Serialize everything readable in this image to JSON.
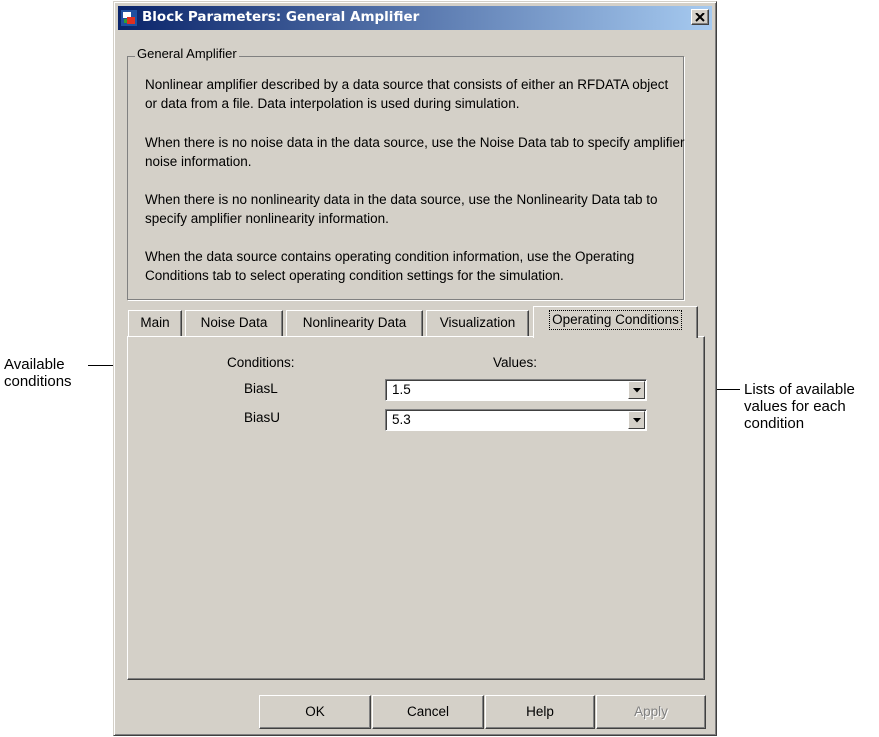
{
  "window": {
    "title": "Block Parameters: General Amplifier",
    "close_icon": "close-icon",
    "app_icon": "simulink-block-icon"
  },
  "group": {
    "label": "General Amplifier",
    "paragraphs": [
      "Nonlinear amplifier described by a data source that consists of either an RFDATA object or data from a file. Data interpolation is used during simulation.",
      "When there is no noise data in the data source, use the Noise Data tab to specify amplifier noise information.",
      "When there is no nonlinearity data in the data source, use the Nonlinearity Data tab to specify amplifier nonlinearity information.",
      "When the data source contains operating condition information, use the Operating Conditions tab to select operating condition settings for the simulation."
    ]
  },
  "tabs": [
    {
      "label": "Main"
    },
    {
      "label": "Noise Data"
    },
    {
      "label": "Nonlinearity Data"
    },
    {
      "label": "Visualization"
    },
    {
      "label": "Operating Conditions",
      "active": true
    }
  ],
  "conditions_panel": {
    "conditions_header": "Conditions:",
    "values_header": "Values:",
    "rows": [
      {
        "condition": "BiasL",
        "value": "1.5"
      },
      {
        "condition": "BiasU",
        "value": "5.3"
      }
    ]
  },
  "buttons": {
    "ok": "OK",
    "cancel": "Cancel",
    "help": "Help",
    "apply": "Apply"
  },
  "annotations": {
    "left": [
      "Available",
      "conditions"
    ],
    "right": [
      "Lists of available",
      "values for each",
      "condition"
    ]
  }
}
